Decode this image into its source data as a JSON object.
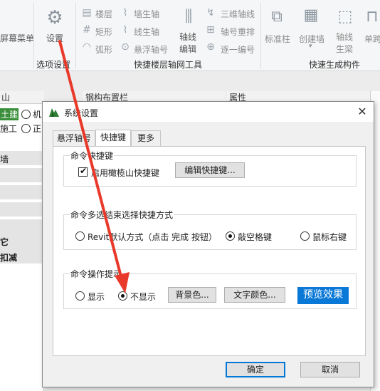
{
  "ribbon": {
    "partial_left_label": "屏幕菜单",
    "settings_label": "设置",
    "group_options_label": "选项设置",
    "floor_axis_items": [
      "楼层",
      "矩形",
      "弧形"
    ],
    "axis_items": [
      "墙生轴",
      "线生轴",
      "悬浮轴号"
    ],
    "axis_edit_label": "轴线编辑",
    "axis_tools": [
      "三维轴线",
      "轴号重排",
      "逐一编号"
    ],
    "group_axis_label": "快捷楼层轴网工具",
    "gen_items": [
      "标准柱",
      "创建墙",
      "轴线生梁",
      "单跨"
    ],
    "group_gen_label": "快速生成构件"
  },
  "background": {
    "left_header": "山",
    "middle_header": "钢构布置栏",
    "right_header": "属性",
    "left_rows": [
      "土建",
      "施工",
      "墙",
      "它",
      "扣减"
    ],
    "left_radio_texts": [
      "机",
      "正"
    ]
  },
  "dialog": {
    "title": "系统设置",
    "tabs": [
      "悬浮轴号",
      "快捷键",
      "更多"
    ],
    "active_tab": "快捷键",
    "group1": {
      "legend": "命令快捷键",
      "checkbox_label": "启用橄榄山快捷键",
      "checked": true,
      "edit_button": "编辑快捷键..."
    },
    "group2": {
      "legend": "命令多选结束选择快捷方式",
      "options": [
        "Revit默认方式（点击 完成 按钮）",
        "敲空格键",
        "鼠标右键"
      ],
      "selected": "敲空格键"
    },
    "group3": {
      "legend": "命令操作提示",
      "options": [
        "显示",
        "不显示"
      ],
      "selected": "不显示",
      "bg_button": "背景色...",
      "text_button": "文字颜色...",
      "preview": "预览效果"
    },
    "ok_button": "确定",
    "cancel_button": "取消",
    "close_symbol": "✕"
  },
  "colors": {
    "accent": "#0078d7",
    "preview_bg": "#0a78d7",
    "arrow": "#e8392a"
  }
}
